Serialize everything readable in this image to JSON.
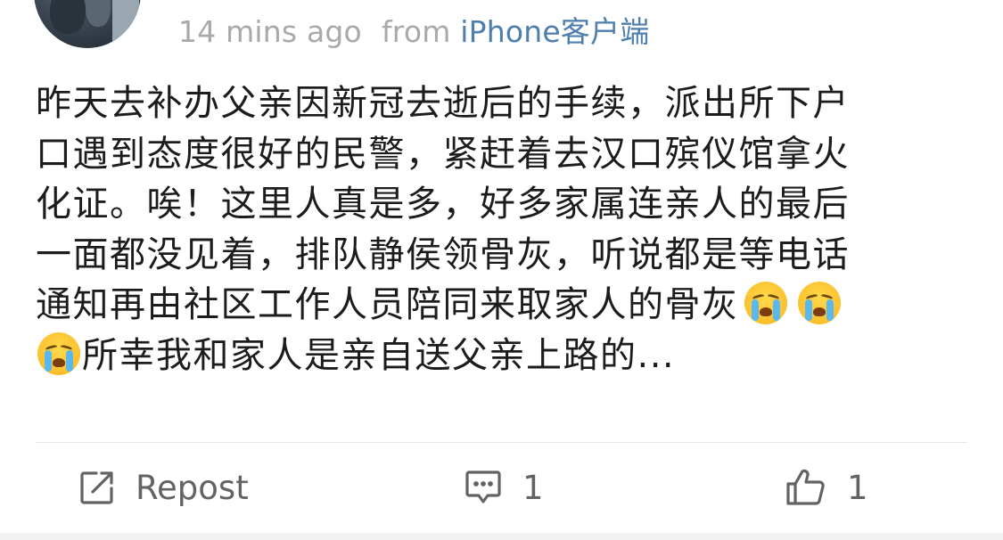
{
  "post": {
    "time": "14 mins ago",
    "from_label": "from",
    "source": "iPhone客户端",
    "content_lines": [
      "昨天去补办父亲因新冠去逝后的手续，派出所下户",
      "口遇到态度很好的民警，紧赶着去汉口殡仪馆拿火",
      "化证。唉！这里人真是多，好多家属连亲人的最后",
      "一面都没见着，排队静侯领骨灰，听说都是等电话",
      "通知再由社区工作人员陪同来取家人的骨灰",
      "所幸我和家人是亲自送父亲上路的..."
    ],
    "emoji": "crying-face-emoji"
  },
  "actions": {
    "repost_label": "Repost",
    "comment_count": "1",
    "like_count": "1"
  },
  "icons": {
    "repost": "repost-icon",
    "comment": "comment-icon",
    "like": "thumbs-up-icon"
  },
  "colors": {
    "source_link": "#4d7ead",
    "meta_text": "#a9a9a9",
    "body_text": "#1c1c1c",
    "action_text": "#636363"
  }
}
